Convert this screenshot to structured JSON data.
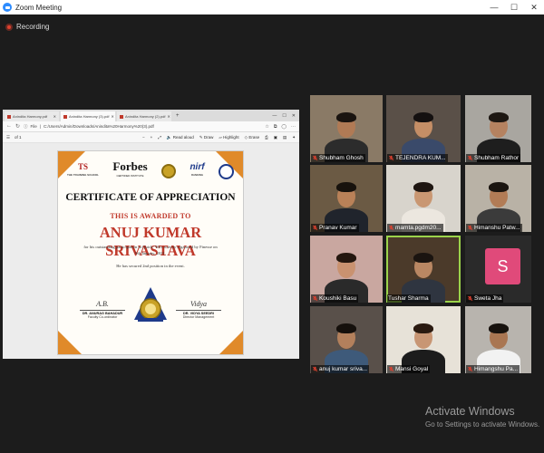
{
  "window": {
    "title": "Zoom Meeting",
    "minimize": "—",
    "maximize": "☐",
    "close": "✕"
  },
  "recording": {
    "label": "Recording"
  },
  "browser": {
    "tabs": [
      {
        "label": "Anindita Harmony.pdf",
        "active": false
      },
      {
        "label": "Anindita Harmony (3).pdf",
        "active": true
      },
      {
        "label": "Anindita Harmony (2).pdf",
        "active": false
      }
    ],
    "new_tab": "+",
    "file_label": "File",
    "address": "C:/Users/Admin/Downloads/Anindita%20Harmony%20(3).pdf",
    "page_indicator": "of 1",
    "toolbar": {
      "read_aloud": "Read aloud",
      "draw": "Draw",
      "highlight": "Highlight",
      "erase": "Erase"
    }
  },
  "certificate": {
    "logo_ts": "TS",
    "logo_ts_sub": "THE TRAINING SCHOOL",
    "logo_forbes": "Forbes",
    "logo_forbes_sub": "CERTIFIED INSTITUTE",
    "logo_nirf": "nirf",
    "logo_nirf_sub": "RANKING",
    "heading": "CERTIFICATE OF APPRECIATION",
    "awarded_to": "THIS IS AWARDED TO",
    "recipient": "ANUJ KUMAR SRIVASTAVA",
    "body": "for his outstanding participation in Quick- Wits activity organised by Finesse on 9th January, 2021.",
    "position": "He has secured 2nd position in the event.",
    "signatory_left": {
      "name": "DR. ANURAG BAHADUR",
      "role": "Faculty Co-ordinator"
    },
    "signatory_right": {
      "name": "DR. VIDYA SEEDRI",
      "role": "Director Management"
    }
  },
  "participants": [
    {
      "name": "Shubham Ghosh",
      "muted": true
    },
    {
      "name": "TEJENDRA KUM...",
      "muted": true
    },
    {
      "name": "Shubham Rathor",
      "muted": true
    },
    {
      "name": "Pranav Kumar",
      "muted": true
    },
    {
      "name": "mamta.pgdm20...",
      "muted": true
    },
    {
      "name": "Himanshu Patw...",
      "muted": true
    },
    {
      "name": "Koushiki Basu",
      "muted": true
    },
    {
      "name": "Tushar Sharma",
      "muted": false,
      "speaking": true
    },
    {
      "name": "Sweta Jha",
      "muted": true,
      "avatar_letter": "S"
    },
    {
      "name": "anuj kumar sriva...",
      "muted": true
    },
    {
      "name": "Mansi Goyal",
      "muted": true
    },
    {
      "name": "Himangshu Pa...",
      "muted": true
    }
  ],
  "watermark": {
    "title": "Activate Windows",
    "subtitle": "Go to Settings to activate Windows."
  },
  "colors": {
    "speaking_border": "#9bd34b",
    "muted_icon": "#e0412f",
    "avatar_bg": "#e04a7a"
  }
}
